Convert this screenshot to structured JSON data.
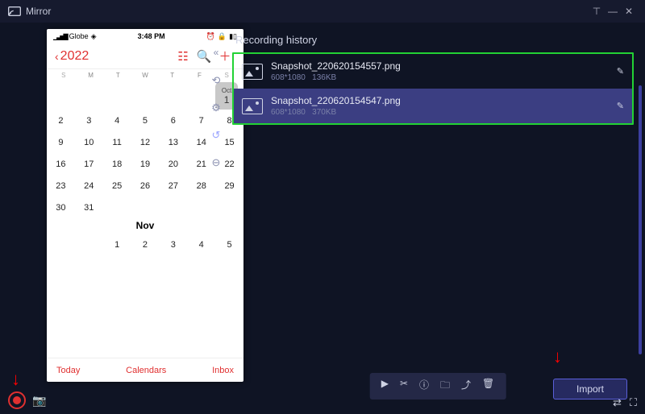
{
  "titlebar": {
    "app_name": "Mirror"
  },
  "phone": {
    "status": {
      "carrier": "Globe",
      "time": "3:48 PM"
    },
    "header": {
      "year": "2022"
    },
    "weekdays": [
      "S",
      "M",
      "T",
      "W",
      "T",
      "F",
      "S"
    ],
    "month1": {
      "label": "Oct",
      "today": "1",
      "weeks": [
        [
          "2",
          "3",
          "4",
          "5",
          "6",
          "7",
          "8"
        ],
        [
          "9",
          "10",
          "11",
          "12",
          "13",
          "14",
          "15"
        ],
        [
          "16",
          "17",
          "18",
          "19",
          "20",
          "21",
          "22"
        ],
        [
          "23",
          "24",
          "25",
          "26",
          "27",
          "28",
          "29"
        ],
        [
          "30",
          "31",
          "",
          "",
          "",
          "",
          ""
        ]
      ]
    },
    "month2": {
      "label": "Nov",
      "weeks": [
        [
          "",
          "",
          "1",
          "2",
          "3",
          "4",
          "5"
        ]
      ]
    },
    "footer": {
      "today": "Today",
      "calendars": "Calendars",
      "inbox": "Inbox"
    }
  },
  "history": {
    "title": "Recording history",
    "items": [
      {
        "name": "Snapshot_220620154557.png",
        "res": "608*1080",
        "size": "136KB",
        "selected": false
      },
      {
        "name": "Snapshot_220620154547.png",
        "res": "608*1080",
        "size": "370KB",
        "selected": true
      }
    ]
  },
  "import_label": "Import"
}
